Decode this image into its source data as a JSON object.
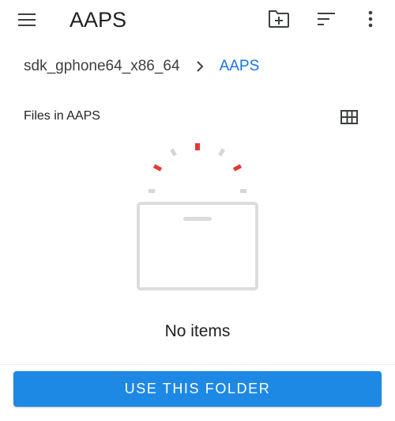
{
  "toolbar": {
    "title": "AAPS",
    "menu_icon": "hamburger-menu-icon",
    "new_folder_icon": "create-new-folder-icon",
    "sort_icon": "sort-icon",
    "more_icon": "more-vert-icon"
  },
  "breadcrumb": {
    "root": "sdk_gphone64_x86_64",
    "separator_icon": "chevron-right-icon",
    "current": "AAPS"
  },
  "files_section": {
    "header": "Files in AAPS",
    "view_toggle_icon": "grid-view-icon"
  },
  "empty_state": {
    "illustration": "empty-folder-illustration",
    "message": "No items"
  },
  "footer": {
    "use_folder_label": "USE THIS FOLDER"
  },
  "colors": {
    "accent": "#1a73e8",
    "button": "#1e88e5",
    "spark_red": "#e53935",
    "spark_gray": "#d6d6d6",
    "box_gray": "#dadce0"
  }
}
